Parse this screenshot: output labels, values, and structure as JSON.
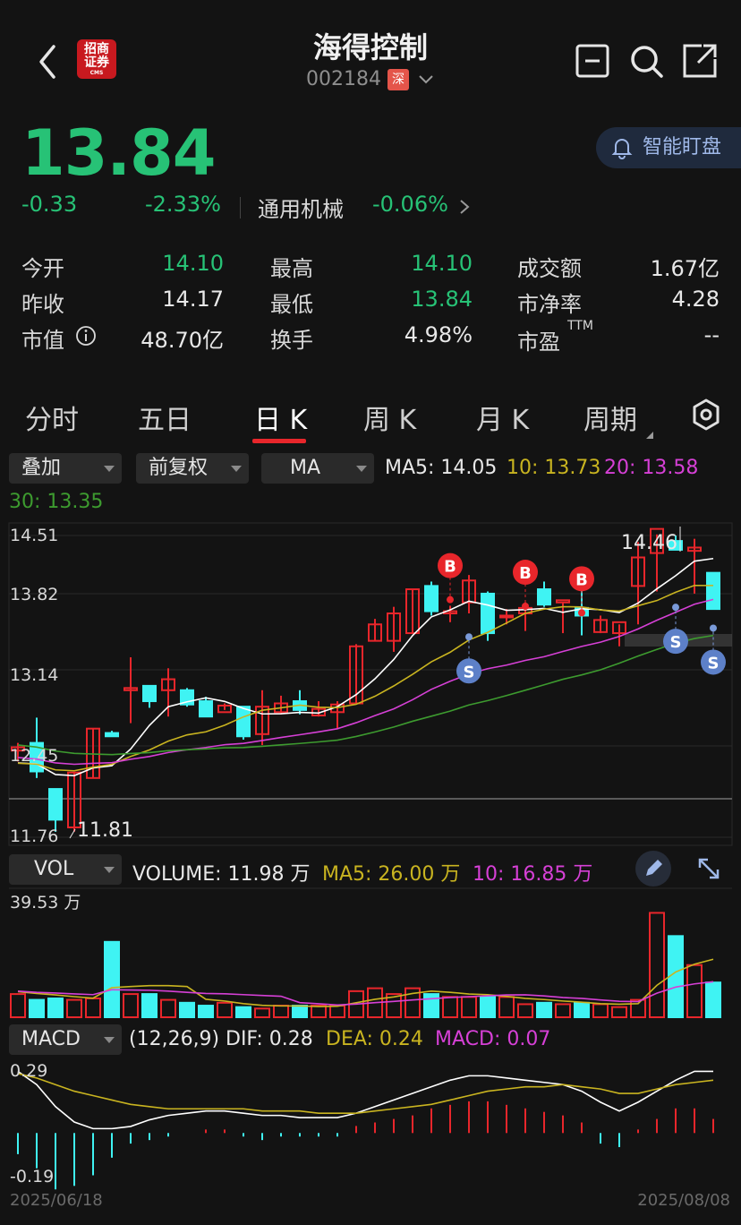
{
  "header": {
    "title": "海得控制",
    "code": "002184",
    "market_badge": "深",
    "logo_line1": "招商",
    "logo_line2": "证券",
    "logo_sub": "CMS"
  },
  "quote": {
    "price": "13.84",
    "change": "-0.33",
    "change_pct": "-2.33%",
    "sector": "通用机械",
    "sector_pct": "-0.06%",
    "smart_button": "智能盯盘"
  },
  "stats": {
    "open_label": "今开",
    "open_value": "14.10",
    "prev_close_label": "昨收",
    "prev_close_value": "14.17",
    "mktcap_label": "市值",
    "mktcap_value": "48.70亿",
    "high_label": "最高",
    "high_value": "14.10",
    "low_label": "最低",
    "low_value": "13.84",
    "turnover_label": "换手",
    "turnover_value": "4.98%",
    "amount_label": "成交额",
    "amount_value": "1.67亿",
    "pb_label": "市净率",
    "pb_value": "4.28",
    "pe_label": "市盈",
    "pe_sup": "TTM",
    "pe_value": "--"
  },
  "tabs": [
    {
      "label": "分时"
    },
    {
      "label": "五日"
    },
    {
      "label": "日 K"
    },
    {
      "label": "周 K"
    },
    {
      "label": "月 K"
    },
    {
      "label": "周期"
    }
  ],
  "controls": {
    "overlay": "叠加",
    "adjust": "前复权",
    "indicator": "MA",
    "ma5": "MA5: 14.05",
    "ma10": "10: 13.73",
    "ma20": "20: 13.58",
    "ma30": "30: 13.35"
  },
  "kline": {
    "y_labels": [
      "14.51",
      "13.82",
      "13.14",
      "12.45",
      "11.76"
    ],
    "high_marker": "14.46",
    "low_marker": "11.81",
    "buy_label": "B",
    "sell_label": "S"
  },
  "volume": {
    "dropdown": "VOL",
    "volume_text": "VOLUME: 11.98 万",
    "ma5_text": "MA5: 26.00 万",
    "ma10_text": "10: 16.85 万",
    "max_label": "39.53 万"
  },
  "macd": {
    "dropdown": "MACD",
    "params": "(12,26,9)",
    "dif": "DIF: 0.28",
    "dea": "DEA: 0.24",
    "macd": "MACD: 0.07",
    "top_label": "0.29",
    "bottom_label": "-0.19",
    "start_date": "2025/06/18",
    "end_date": "2025/08/08"
  },
  "colors": {
    "up": "#e8262b",
    "down": "#3ff3f3",
    "price_green": "#27c276",
    "ma5": "#ffffff",
    "ma10": "#c9b420",
    "ma20": "#d640d6",
    "ma30": "#3d9b2f"
  }
}
